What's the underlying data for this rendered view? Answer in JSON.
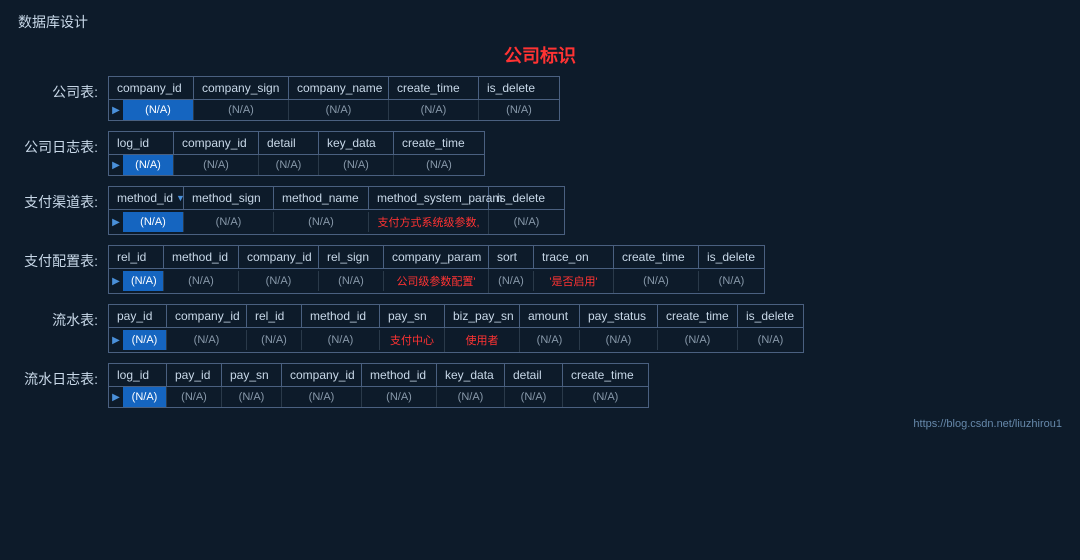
{
  "page": {
    "title": "数据库设计",
    "center_label": "公司标识",
    "footer_url": "https://blog.csdn.net/liuzhirou1"
  },
  "tables": [
    {
      "label": "公司表:",
      "columns": [
        "company_id",
        "company_sign",
        "company_name",
        "create_time",
        "is_delete"
      ],
      "row": [
        "(N/A)",
        "(N/A)",
        "(N/A)",
        "(N/A)",
        "(N/A)"
      ],
      "highlighted_col": 0,
      "red_cols": [],
      "widths": [
        85,
        95,
        100,
        90,
        80
      ]
    },
    {
      "label": "公司日志表:",
      "columns": [
        "log_id",
        "company_id",
        "detail",
        "key_data",
        "create_time"
      ],
      "row": [
        "(N/A)",
        "(N/A)",
        "(N/A)",
        "(N/A)",
        "(N/A)"
      ],
      "highlighted_col": 0,
      "red_cols": [],
      "widths": [
        65,
        85,
        60,
        75,
        90
      ]
    },
    {
      "label": "支付渠道表:",
      "columns": [
        "method_id",
        "method_sign",
        "method_name",
        "method_system_param",
        "is_delete"
      ],
      "row": [
        "(N/A)",
        "(N/A)",
        "(N/A)",
        "支付方式系统级参数,",
        "(N/A)"
      ],
      "highlighted_col": 0,
      "red_cols": [
        3
      ],
      "widths": [
        75,
        90,
        95,
        120,
        75
      ],
      "has_arrow": true
    },
    {
      "label": "支付配置表:",
      "columns": [
        "rel_id",
        "method_id",
        "company_id",
        "rel_sign",
        "company_param",
        "sort",
        "trace_on",
        "create_time",
        "is_delete"
      ],
      "row": [
        "(N/A)",
        "(N/A)",
        "(N/A)",
        "(N/A)",
        "公司级参数配置'",
        "(N/A)",
        "'是否启用'",
        "(N/A)",
        "(N/A)"
      ],
      "highlighted_col": 0,
      "red_cols": [
        4,
        6
      ],
      "widths": [
        55,
        75,
        80,
        65,
        105,
        45,
        80,
        85,
        65
      ]
    },
    {
      "label": "流水表:",
      "columns": [
        "pay_id",
        "company_id",
        "rel_id",
        "method_id",
        "pay_sn",
        "biz_pay_sn",
        "amount",
        "pay_status",
        "create_time",
        "is_delete"
      ],
      "row": [
        "(N/A)",
        "(N/A)",
        "(N/A)",
        "(N/A)",
        "支付中心",
        "使用者",
        "(N/A)",
        "(N/A)",
        "(N/A)",
        "(N/A)"
      ],
      "highlighted_col": 0,
      "red_cols": [
        4,
        5
      ],
      "widths": [
        58,
        80,
        55,
        78,
        65,
        75,
        60,
        78,
        80,
        65
      ]
    },
    {
      "label": "流水日志表:",
      "columns": [
        "log_id",
        "pay_id",
        "pay_sn",
        "company_id",
        "method_id",
        "key_data",
        "detail",
        "create_time"
      ],
      "row": [
        "(N/A)",
        "(N/A)",
        "(N/A)",
        "(N/A)",
        "(N/A)",
        "(N/A)",
        "(N/A)",
        "(N/A)"
      ],
      "highlighted_col": 0,
      "red_cols": [],
      "widths": [
        58,
        55,
        60,
        80,
        75,
        68,
        58,
        85
      ]
    }
  ]
}
